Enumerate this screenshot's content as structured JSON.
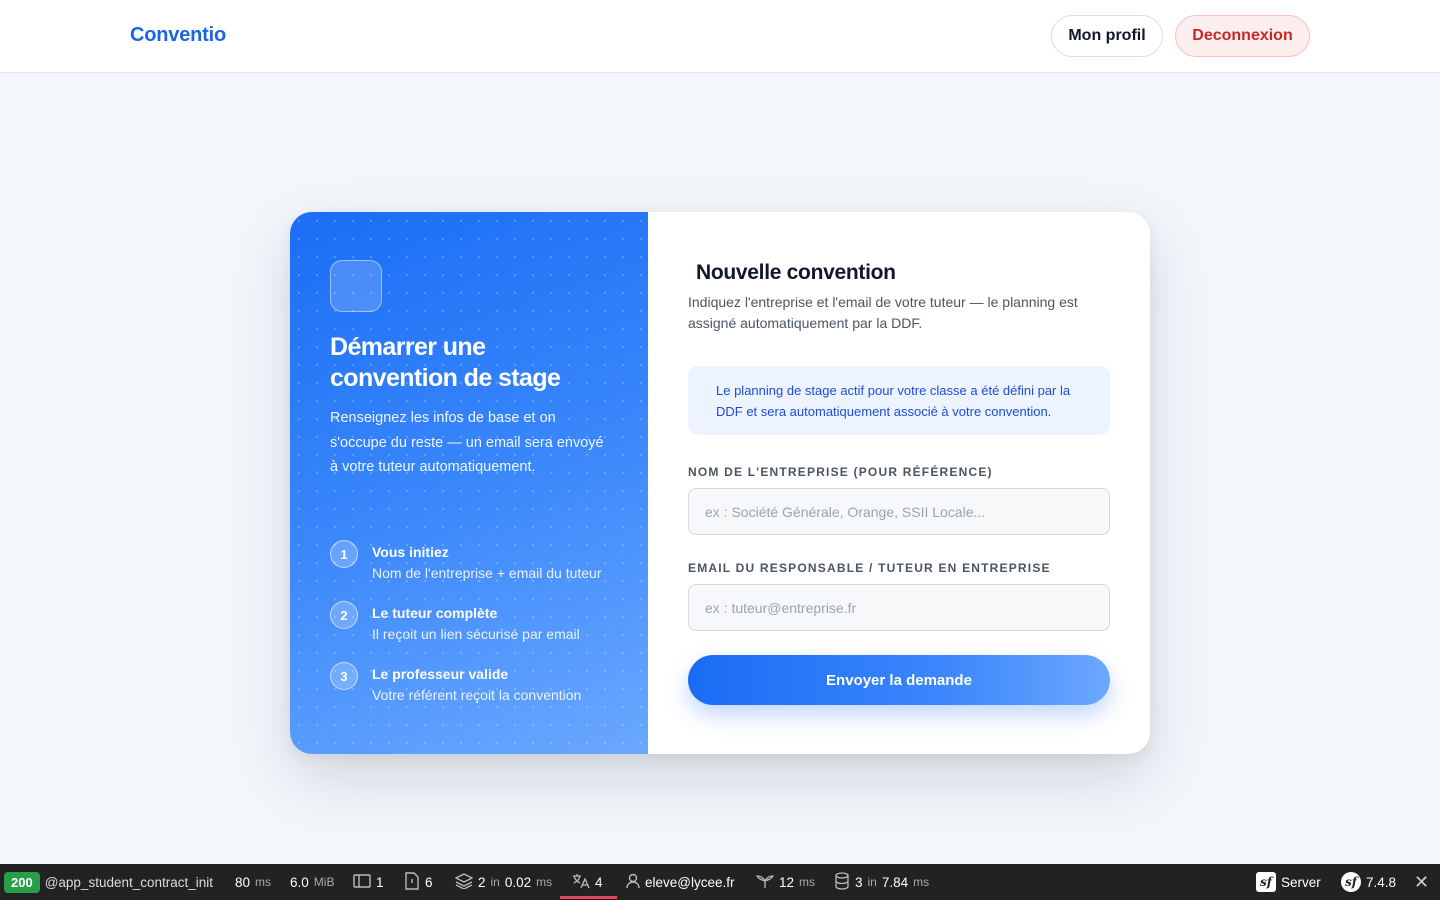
{
  "header": {
    "brand": "Conventio",
    "profile_label": "Mon profil",
    "logout_label": "Deconnexion"
  },
  "sidebar": {
    "title": "Démarrer une convention de stage",
    "description": "Renseignez les infos de base et on s'occupe du reste — un email sera envoyé à votre tuteur automatiquement.",
    "steps": [
      {
        "number": "1",
        "title": "Vous initiez",
        "subtitle": "Nom de l'entreprise + email du tuteur"
      },
      {
        "number": "2",
        "title": "Le tuteur complète",
        "subtitle": "Il reçoit un lien sécurisé par email"
      },
      {
        "number": "3",
        "title": "Le professeur valide",
        "subtitle": "Votre référent reçoit la convention"
      }
    ]
  },
  "form": {
    "title": "Nouvelle convention",
    "description": "Indiquez l'entreprise et l'email de votre tuteur — le planning est assigné automatiquement par la DDF.",
    "info": "Le planning de stage actif pour votre classe a été défini par la DDF et sera automatiquement associé à votre convention.",
    "company_label": "NOM DE L'ENTREPRISE (POUR RÉFÉRENCE)",
    "company_placeholder": "ex : Société Générale, Orange, SSII Locale...",
    "company_value": "",
    "email_label": "EMAIL DU RESPONSABLE / TUTEUR EN ENTREPRISE",
    "email_placeholder": "ex : tuteur@entreprise.fr",
    "email_value": "",
    "submit_label": "Envoyer la demande"
  },
  "colors": {
    "accent": "#1d63e8",
    "logout_text": "#c62828",
    "status_ok": "#2a9d4b"
  },
  "debugbar": {
    "status": "200",
    "route": "@app_student_contract_init",
    "time_value": "80",
    "time_unit": "ms",
    "memory_value": "6.0",
    "memory_unit": "MiB",
    "forms_count": "1",
    "templates_count": "6",
    "cache_count": "2",
    "cache_in": "in",
    "cache_time": "0.02",
    "cache_unit": "ms",
    "translation_count": "4",
    "user": "eleve@lycee.fr",
    "twig_time": "12",
    "twig_unit": "ms",
    "db_count": "3",
    "db_in": "in",
    "db_time": "7.84",
    "db_unit": "ms",
    "server_label": "Server",
    "symfony_version": "7.4.8"
  }
}
